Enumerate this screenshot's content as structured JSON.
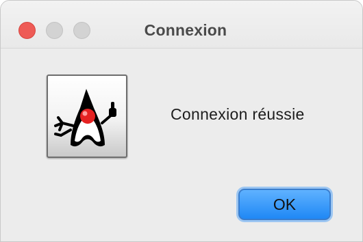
{
  "window": {
    "title": "Connexion"
  },
  "dialog": {
    "icon": "java-duke-icon",
    "message": "Connexion réussie",
    "ok_label": "OK"
  },
  "colors": {
    "close_button": "#ee5b56",
    "inactive_button": "#d3d3d3",
    "ok_button": "#1f88f5",
    "background": "#ececec"
  }
}
